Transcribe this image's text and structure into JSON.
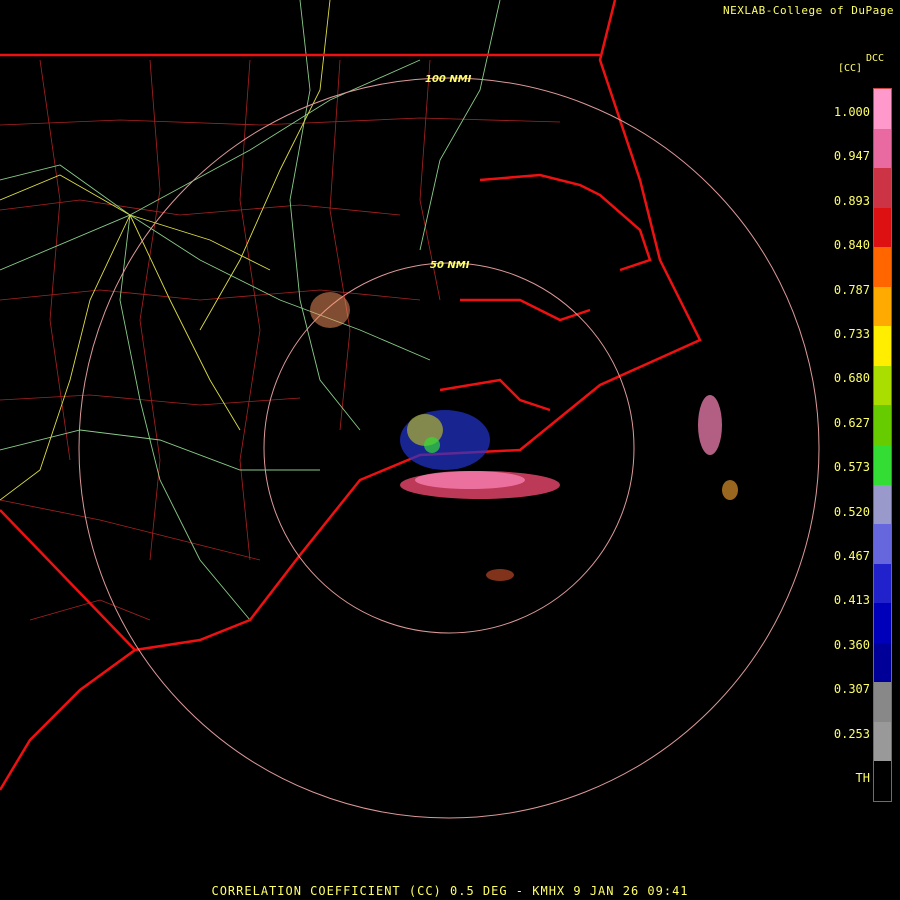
{
  "credit": "NEXLAB-College of DuPage",
  "legend": {
    "title": "DCC",
    "unit": "[CC]",
    "ticks": [
      "1.000",
      "0.947",
      "0.893",
      "0.840",
      "0.787",
      "0.733",
      "0.680",
      "0.627",
      "0.573",
      "0.520",
      "0.467",
      "0.413",
      "0.360",
      "0.307",
      "0.253",
      "TH"
    ],
    "colors": [
      "#ff99cc",
      "#e86aa0",
      "#cc3344",
      "#dd1111",
      "#ff6600",
      "#ffaa00",
      "#ffee00",
      "#aadd00",
      "#66cc00",
      "#33dd33",
      "#9999cc",
      "#6666dd",
      "#2222cc",
      "#0000bb",
      "#000099",
      "#888888",
      "#999999",
      "#000000"
    ]
  },
  "range_rings": {
    "inner_label": "50 NMI",
    "outer_label": "100 NMI"
  },
  "footer": "CORRELATION COEFFICIENT (CC) 0.5 DEG - KMHX 9 JAN 26 09:41"
}
